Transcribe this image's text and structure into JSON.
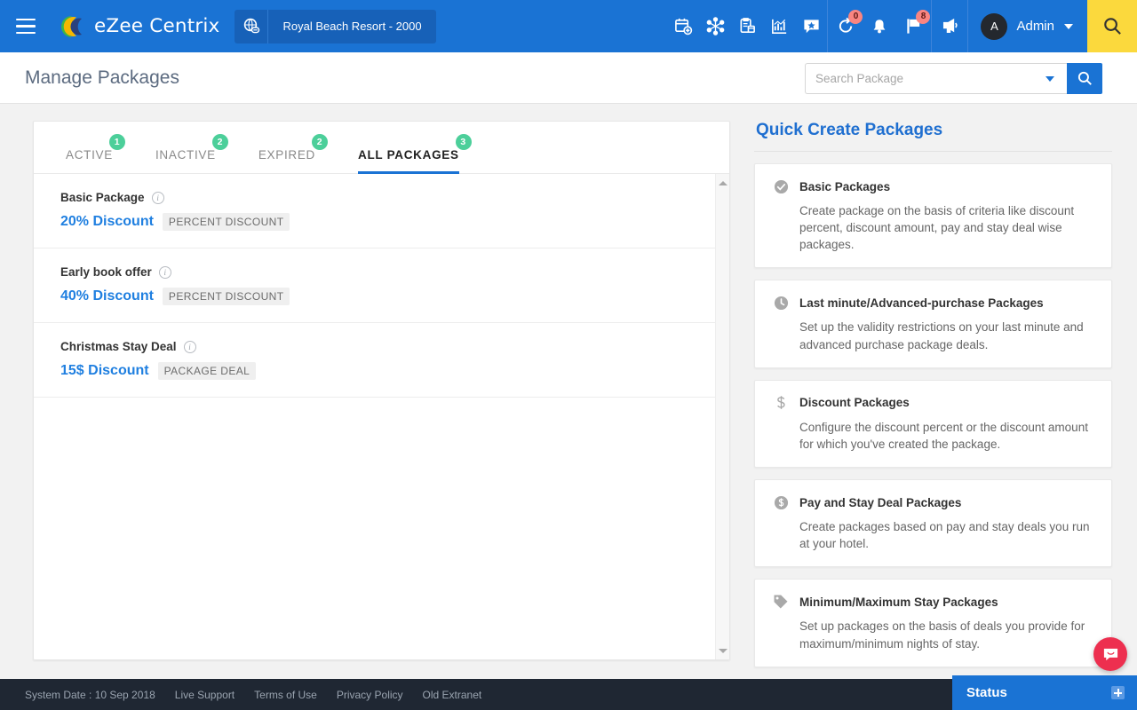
{
  "header": {
    "menu_icon": "hamburger-icon",
    "brand": "eZee Centrix",
    "property": "Royal Beach Resort -  2000",
    "property_icon": "globe-link-icon",
    "icons": [
      {
        "name": "calendar-add-icon",
        "label": "Add Booking"
      },
      {
        "name": "network-scissors-icon",
        "label": "Channel Manager"
      },
      {
        "name": "clipboard-icon",
        "label": "Reports"
      },
      {
        "name": "chart-icon",
        "label": "Analytics"
      },
      {
        "name": "star-message-icon",
        "label": "Reviews"
      }
    ],
    "status_icons": [
      {
        "name": "sync-history-icon",
        "badge": "0"
      },
      {
        "name": "bell-icon",
        "badge": ""
      },
      {
        "name": "flag-icon",
        "badge": "8"
      }
    ],
    "announce_icon": "megaphone-icon",
    "user": {
      "initial": "A",
      "name": "Admin"
    },
    "search_icon": "search-icon"
  },
  "page": {
    "title": "Manage Packages"
  },
  "search": {
    "placeholder": "Search Package",
    "value": "",
    "dropdown_icon": "chevron-down-icon",
    "submit_icon": "search-icon"
  },
  "tabs": [
    {
      "label": "ACTIVE",
      "count": "1",
      "active": false
    },
    {
      "label": "INACTIVE",
      "count": "2",
      "active": false
    },
    {
      "label": "EXPIRED",
      "count": "2",
      "active": false
    },
    {
      "label": "ALL PACKAGES",
      "count": "3",
      "active": true
    }
  ],
  "packages": [
    {
      "name": "Basic Package",
      "discount": "20% Discount",
      "tag": "PERCENT DISCOUNT"
    },
    {
      "name": "Early book offer",
      "discount": "40% Discount",
      "tag": "PERCENT DISCOUNT"
    },
    {
      "name": "Christmas Stay Deal",
      "discount": "15$ Discount",
      "tag": "PACKAGE DEAL"
    }
  ],
  "quick_create": {
    "title": "Quick Create Packages",
    "cards": [
      {
        "icon": "check-circle-icon",
        "title": "Basic Packages",
        "desc": "Create package on the basis of criteria like discount percent, discount amount, pay and stay deal wise packages."
      },
      {
        "icon": "clock-icon",
        "title": "Last minute/Advanced-purchase Packages",
        "desc": "Set up the validity restrictions on your last minute and advanced purchase package deals."
      },
      {
        "icon": "dollar-icon",
        "title": "Discount Packages",
        "desc": "Configure the discount percent or the discount amount for which you've created the package."
      },
      {
        "icon": "dollar-circle-icon",
        "title": "Pay and Stay Deal Packages",
        "desc": "Create packages based on pay and stay deals you run at your hotel."
      },
      {
        "icon": "tag-icon",
        "title": "Minimum/Maximum Stay Packages",
        "desc": "Set up packages on the basis of deals you provide for maximum/minimum nights of stay."
      }
    ]
  },
  "chat": {
    "icon": "chat-bubble-icon"
  },
  "footer": {
    "system_date": "System Date : 10 Sep 2018",
    "links": [
      "Live Support",
      "Terms of Use",
      "Privacy Policy",
      "Old Extranet"
    ],
    "status_label": "Status",
    "status_icon": "expand-plus-icon"
  },
  "colors": {
    "header_blue": "#1a73d4",
    "accent_blue": "#1f7fe0",
    "badge_green": "#4ccf9a",
    "search_yellow": "#fbd93d",
    "chat_red": "#ed2f4f",
    "footer_dark": "#1f2733"
  }
}
